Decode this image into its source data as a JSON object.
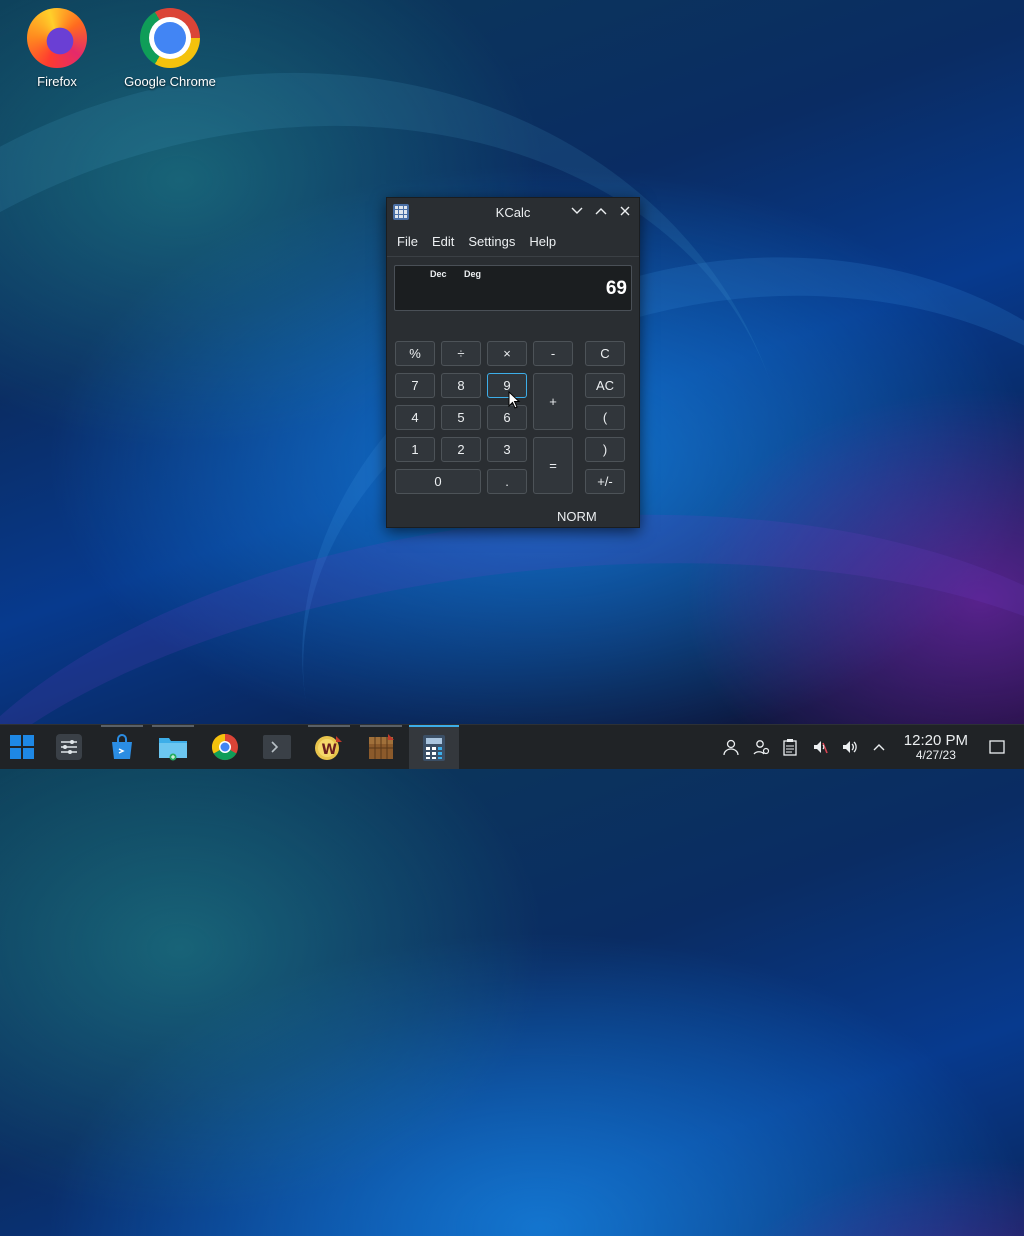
{
  "desktop": {
    "icons": [
      {
        "label": "Firefox"
      },
      {
        "label": "Google Chrome"
      }
    ]
  },
  "window": {
    "title": "KCalc",
    "menu": [
      "File",
      "Edit",
      "Settings",
      "Help"
    ],
    "display": {
      "base_indicator": "Dec",
      "angle_indicator": "Deg",
      "value": "69"
    },
    "keys": {
      "percent": "%",
      "divide": "÷",
      "multiply": "×",
      "minus": "-",
      "clear": "C",
      "seven": "7",
      "eight": "8",
      "nine": "9",
      "plus": "+",
      "all_clear": "AC",
      "four": "4",
      "five": "5",
      "six": "6",
      "open_paren": "(",
      "one": "1",
      "two": "2",
      "three": "3",
      "equals": "=",
      "close_paren": ")",
      "zero": "0",
      "decimal": ".",
      "sign": "+/-"
    },
    "mode": "NORM"
  },
  "taskbar": {
    "apps": [
      "application-launcher",
      "system-settings",
      "discover",
      "dolphin-file-manager",
      "google-chrome",
      "konsole",
      "wine",
      "minecraft",
      "kcalc"
    ],
    "active_app": "kcalc",
    "clock": {
      "time": "12:20 PM",
      "date": "4/27/23"
    }
  },
  "colors": {
    "accent": "#3daee9",
    "window_bg": "#2a2e32",
    "taskbar_bg": "#202326"
  }
}
